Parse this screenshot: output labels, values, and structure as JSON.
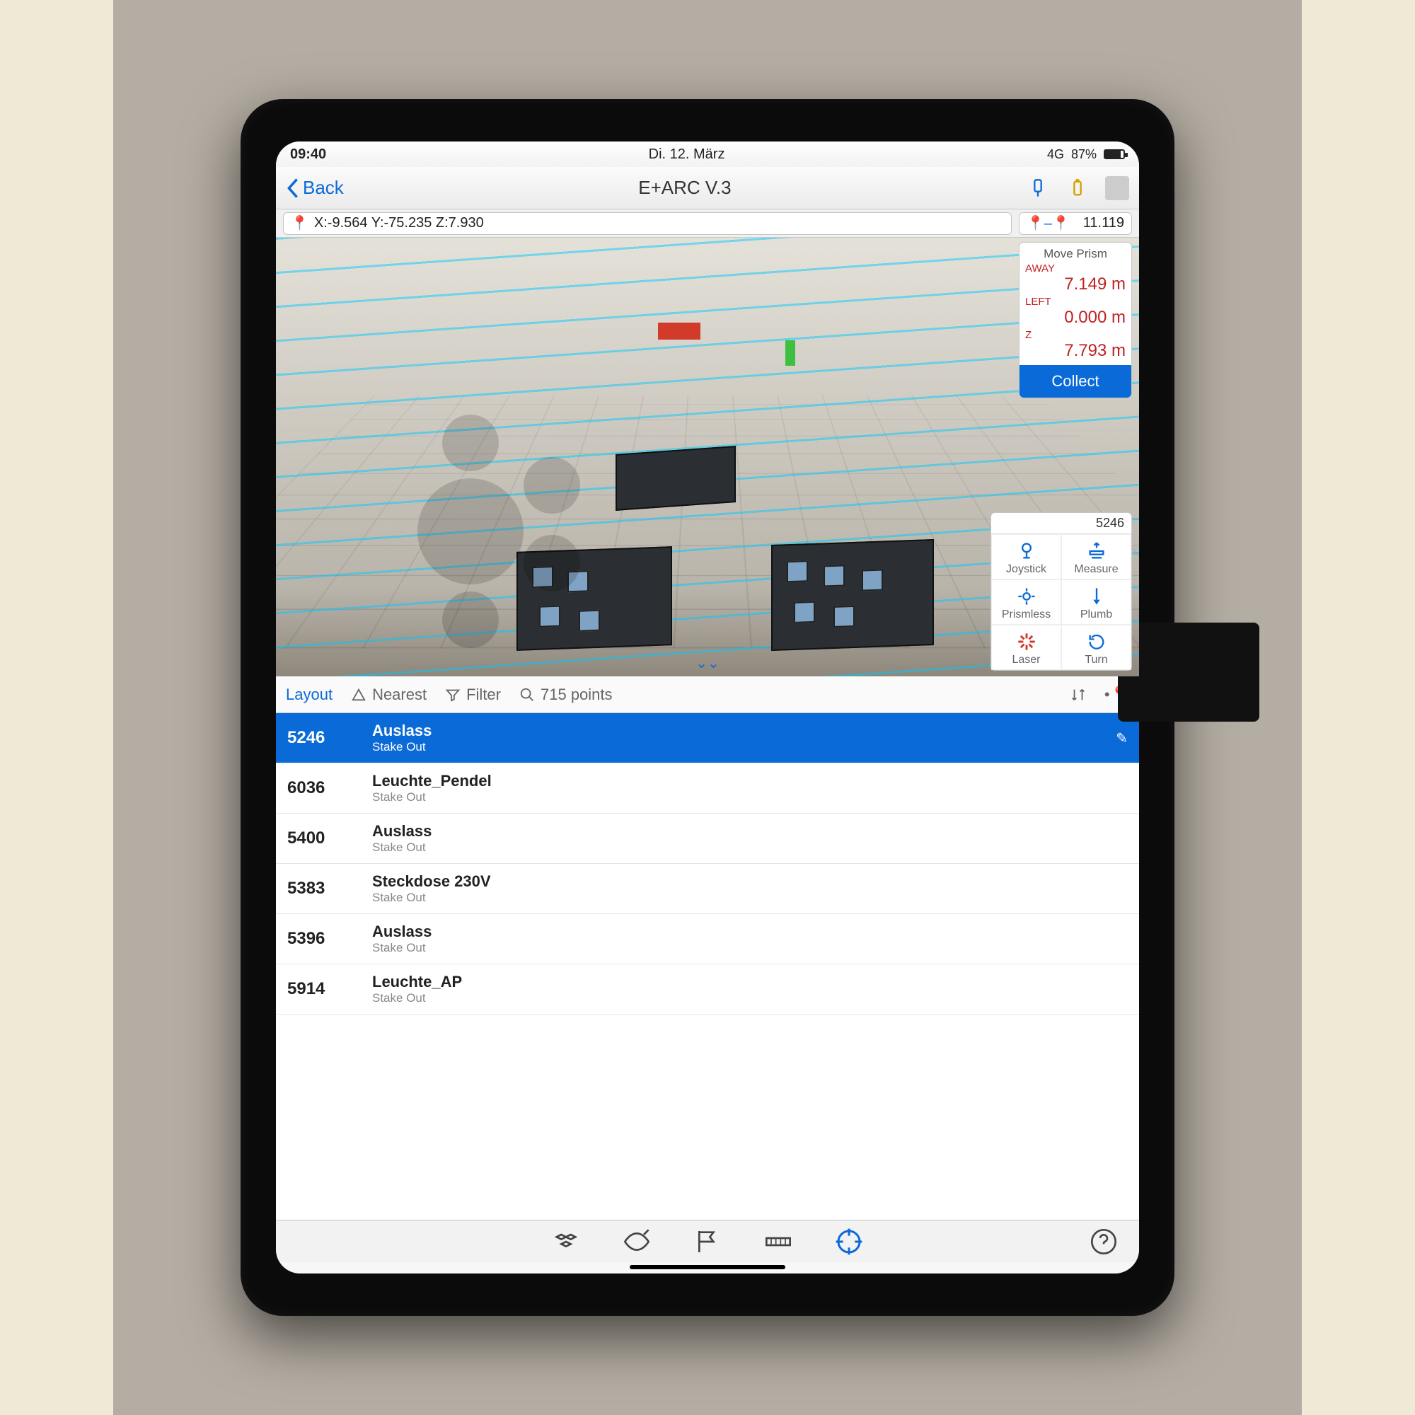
{
  "statusbar": {
    "time": "09:40",
    "date": "Di. 12. März",
    "network": "4G",
    "battery": "87%"
  },
  "header": {
    "back": "Back",
    "title": "E+ARC V.3"
  },
  "coords": {
    "text": "X:-9.564   Y:-75.235   Z:7.930",
    "distance": "11.119"
  },
  "prism": {
    "title": "Move Prism",
    "away_label": "AWAY",
    "away_val": "7.149 m",
    "left_label": "LEFT",
    "left_val": "0.000 m",
    "z_label": "Z",
    "z_val": "7.793 m",
    "collect": "Collect"
  },
  "toolgrid": {
    "header": "5246",
    "items": [
      {
        "label": "Joystick"
      },
      {
        "label": "Measure"
      },
      {
        "label": "Prismless"
      },
      {
        "label": "Plumb"
      },
      {
        "label": "Laser"
      },
      {
        "label": "Turn"
      }
    ]
  },
  "filterbar": {
    "layout": "Layout",
    "nearest": "Nearest",
    "filter": "Filter",
    "points": "715 points"
  },
  "points": [
    {
      "id": "5246",
      "name": "Auslass",
      "sub": "Stake Out",
      "selected": true
    },
    {
      "id": "6036",
      "name": "Leuchte_Pendel",
      "sub": "Stake Out"
    },
    {
      "id": "5400",
      "name": "Auslass",
      "sub": "Stake Out"
    },
    {
      "id": "5383",
      "name": "Steckdose 230V",
      "sub": "Stake Out"
    },
    {
      "id": "5396",
      "name": "Auslass",
      "sub": "Stake Out"
    },
    {
      "id": "5914",
      "name": "Leuchte_AP",
      "sub": "Stake Out"
    }
  ]
}
